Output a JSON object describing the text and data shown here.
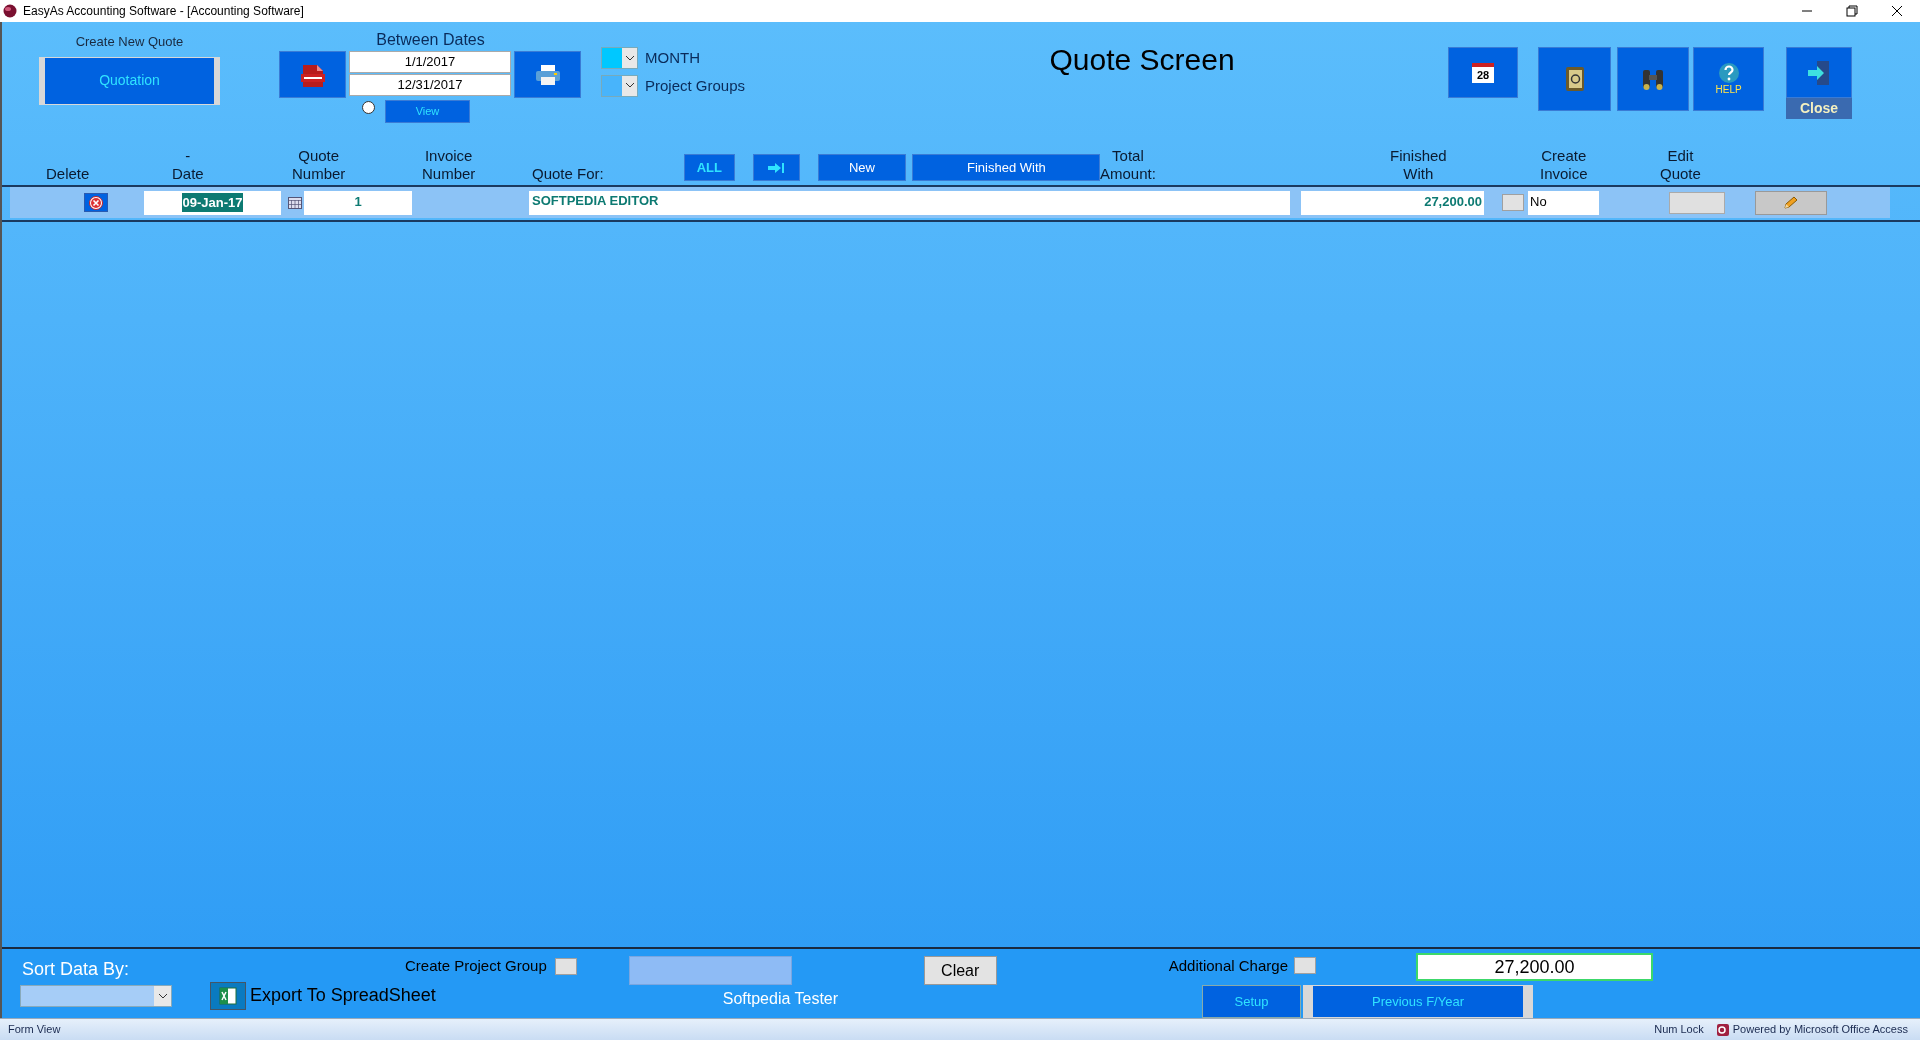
{
  "window": {
    "title": "EasyAs Accounting Software - [Accounting Software]"
  },
  "header": {
    "create_label": "Create New Quote",
    "quotation_button": "Quotation",
    "between_dates_label": "Between Dates",
    "date_from": "1/1/2017",
    "date_to": "12/31/2017",
    "view_option": {
      "selected": false
    },
    "view_button": "View",
    "filters": [
      {
        "label": "MONTH",
        "selected": true
      },
      {
        "label": "Project Groups",
        "selected": false
      }
    ],
    "title": "Quote Screen",
    "calendar_day": "28",
    "help_label": "HELP",
    "close_label": "Close"
  },
  "columns": [
    {
      "lines": [
        "Delete"
      ]
    },
    {
      "lines": [
        "-",
        "Date"
      ]
    },
    {
      "lines": [
        "Quote",
        "Number"
      ]
    },
    {
      "lines": [
        "Invoice",
        "Number"
      ]
    },
    {
      "lines": [
        "Quote For:"
      ]
    },
    {
      "lines": [
        "Total",
        "Amount:"
      ]
    },
    {
      "lines": [
        "Finished",
        "With"
      ]
    },
    {
      "lines": [
        "Create",
        "Invoice"
      ]
    },
    {
      "lines": [
        "Edit",
        "Quote"
      ]
    }
  ],
  "filter_buttons": [
    {
      "kind": "text",
      "label": "ALL"
    },
    {
      "kind": "icon"
    },
    {
      "kind": "text",
      "label": "New"
    },
    {
      "kind": "text",
      "label": "Finished With"
    }
  ],
  "rows": [
    {
      "date": "09-Jan-17",
      "date_selected": true,
      "quote_number": "1",
      "quote_for": "SOFTPEDIA EDITOR",
      "total": "27,200.00",
      "finished_with": false,
      "finished_text": "No"
    }
  ],
  "footer": {
    "sort_label": "Sort Data By:",
    "export_label": "Export To SpreadSheet",
    "create_project_group": {
      "label": "Create Project Group",
      "checked": false
    },
    "clear_button": "Clear",
    "user": "Softpedia Tester",
    "additional_charge": {
      "label": "Additional Charge",
      "checked": false
    },
    "total": "27,200.00",
    "setup_button": "Setup",
    "previous_button": "Previous F/Year"
  },
  "status_bar": {
    "mode": "Form View",
    "num_lock": "Num Lock",
    "powered_by": "Powered by Microsoft Office Access"
  }
}
